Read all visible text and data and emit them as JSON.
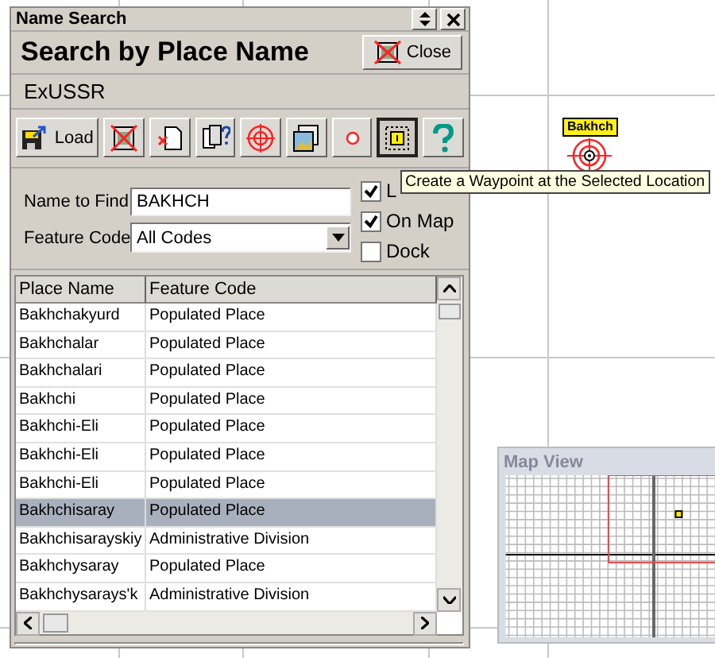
{
  "window": {
    "title": "Name Search",
    "heading": "Search by Place Name",
    "close_label": "Close",
    "database": "ExUSSR"
  },
  "toolbar": [
    {
      "kind": "load",
      "label": "Load",
      "pressed": false
    },
    {
      "kind": "clear",
      "pressed": false
    },
    {
      "kind": "page",
      "pressed": false
    },
    {
      "kind": "query",
      "pressed": false
    },
    {
      "kind": "target",
      "pressed": false
    },
    {
      "kind": "image",
      "pressed": false
    },
    {
      "kind": "circle",
      "pressed": false
    },
    {
      "kind": "waypoint",
      "pressed": true
    },
    {
      "kind": "help",
      "pressed": false
    }
  ],
  "form": {
    "name_label": "Name to Find",
    "name_value": "BAKHCH",
    "code_label": "Feature Code",
    "code_value": "All Codes"
  },
  "options": [
    {
      "label": "L",
      "checked": true
    },
    {
      "label": "On Map",
      "checked": true
    },
    {
      "label": "Dock",
      "checked": false
    }
  ],
  "tooltip": "Create a Waypoint at the Selected Location",
  "table": {
    "columns": [
      "Place Name",
      "Feature Code"
    ],
    "rows": [
      {
        "cells": [
          "Bakhchakyurd",
          "Populated Place"
        ],
        "selected": false
      },
      {
        "cells": [
          "Bakhchalar",
          "Populated Place"
        ],
        "selected": false
      },
      {
        "cells": [
          "Bakhchalari",
          "Populated Place"
        ],
        "selected": false
      },
      {
        "cells": [
          "Bakhchi",
          "Populated Place"
        ],
        "selected": false
      },
      {
        "cells": [
          "Bakhchi-Eli",
          "Populated Place"
        ],
        "selected": false
      },
      {
        "cells": [
          "Bakhchi-Eli",
          "Populated Place"
        ],
        "selected": false
      },
      {
        "cells": [
          "Bakhchi-Eli",
          "Populated Place"
        ],
        "selected": false
      },
      {
        "cells": [
          "Bakhchisaray",
          "Populated Place"
        ],
        "selected": true
      },
      {
        "cells": [
          "Bakhchisarayskiy",
          "Administrative Division"
        ],
        "selected": false
      },
      {
        "cells": [
          "Bakhchysaray",
          "Populated Place"
        ],
        "selected": false
      },
      {
        "cells": [
          "Bakhchysarays'k",
          "Administrative Division"
        ],
        "selected": false
      }
    ]
  },
  "map_marker": {
    "label": "Bakhch"
  },
  "map_view": {
    "title": "Map View"
  }
}
